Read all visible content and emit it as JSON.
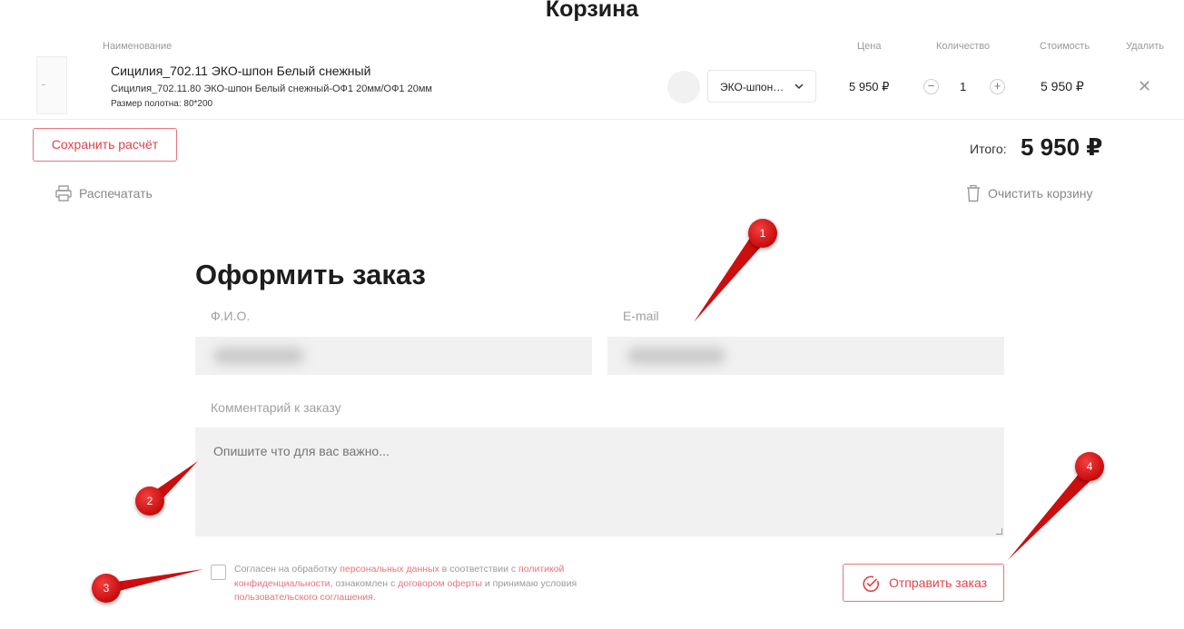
{
  "page": {
    "title": "Корзина"
  },
  "cart": {
    "columns": {
      "name": "Наименование",
      "price": "Цена",
      "quantity": "Количество",
      "cost": "Стоимость",
      "remove": "Удалить"
    },
    "item": {
      "name": "Сицилия_702.11 ЭКО-шпон Белый снежный",
      "sku": "Сицилия_702.11.80 ЭКО-шпон Белый снежный-ОФ1 20мм/ОФ1 20мм",
      "size": "Размер полотна: 80*200",
      "variant": "ЭКО-шпон…",
      "price": "5 950 ₽",
      "quantity": "1",
      "cost": "5 950 ₽"
    },
    "save_button": "Сохранить расчёт",
    "total_label": "Итого:",
    "total_value": "5 950 ₽",
    "print_label": "Распечатать",
    "clear_label": "Очистить корзину"
  },
  "order": {
    "heading": "Оформить заказ",
    "fio_label": "Ф.И.О.",
    "email_label": "E-mail",
    "comment_label": "Комментарий к заказу",
    "comment_placeholder": "Опишите что для вас важно...",
    "consent": {
      "t1": "Согласен на обработку ",
      "l1": "персональных данных",
      "t2": " в соответствии с ",
      "l2": "политикой конфиденциальности",
      "t3": ", ознакомлен с ",
      "l3": "договором оферты",
      "t4": " и принимаю условия ",
      "l4": "пользовательского соглашения",
      "t5": "."
    },
    "submit_button": "Отправить заказ"
  },
  "annotations": {
    "m1": "1",
    "m2": "2",
    "m3": "3",
    "m4": "4"
  },
  "colors": {
    "accent": "#e0424c",
    "accent_light": "#e8747b",
    "field_bg": "#f1f1f1",
    "marker": "#d01010"
  },
  "icons": {
    "print": "printer-icon",
    "clear": "trash-icon",
    "remove": "close-icon",
    "variant": "chevron-down-icon",
    "submit": "check-circle-icon"
  }
}
